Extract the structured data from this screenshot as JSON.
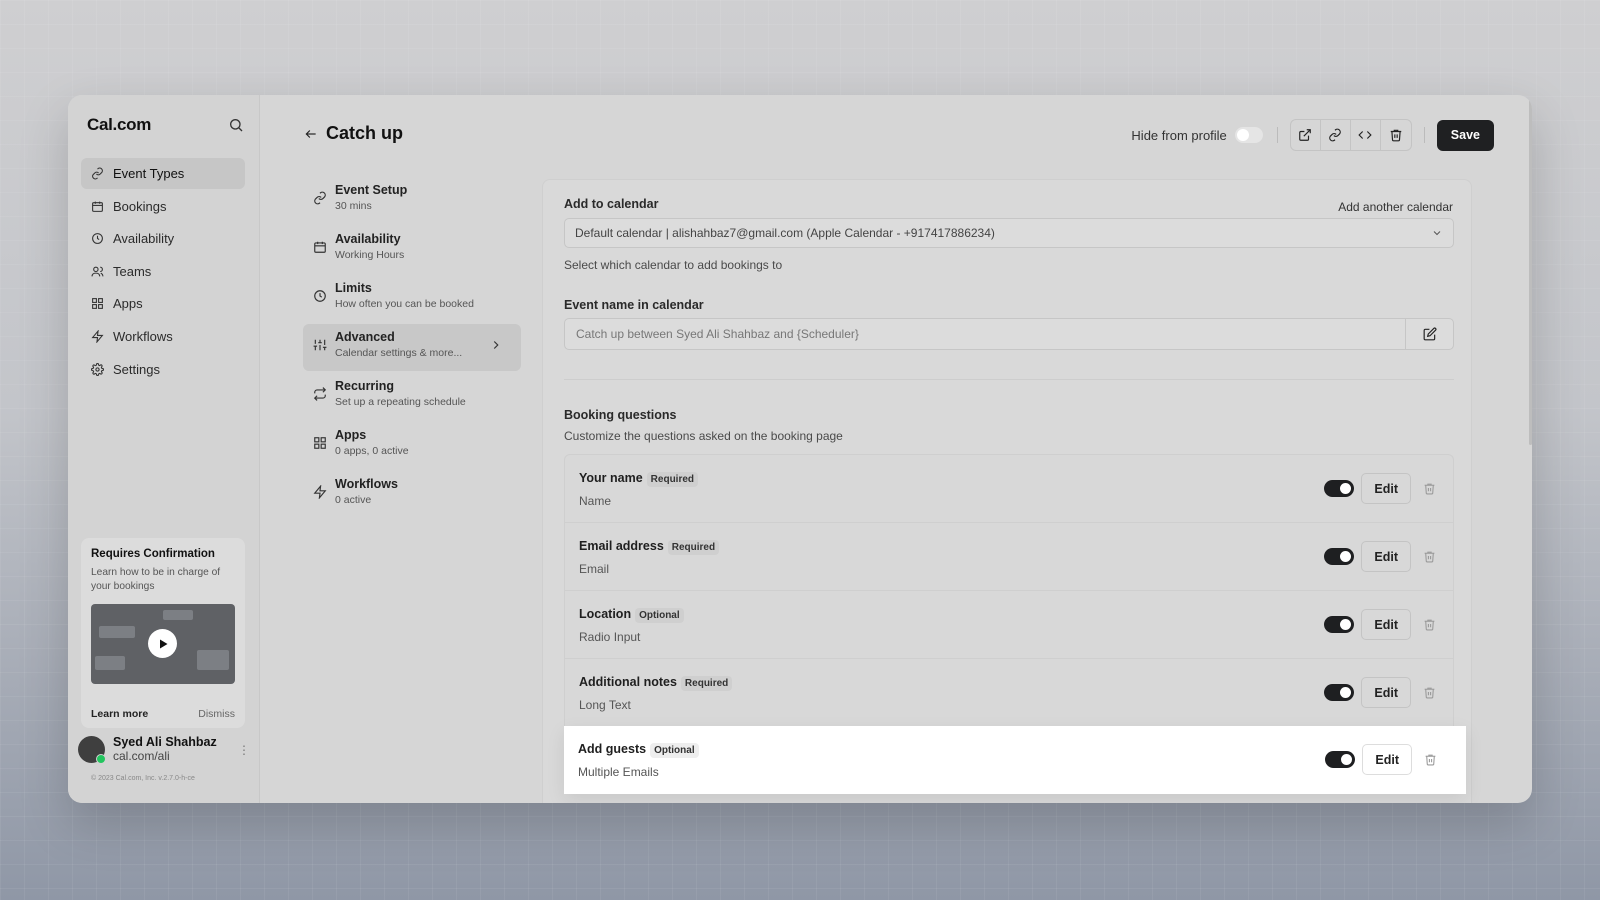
{
  "app": {
    "logo": "Cal.com"
  },
  "sidebar": {
    "items": [
      {
        "label": "Event Types",
        "icon": "link-icon",
        "active": true
      },
      {
        "label": "Bookings",
        "icon": "calendar-icon",
        "active": false
      },
      {
        "label": "Availability",
        "icon": "clock-icon",
        "active": false
      },
      {
        "label": "Teams",
        "icon": "users-icon",
        "active": false
      },
      {
        "label": "Apps",
        "icon": "grid-icon",
        "active": false
      },
      {
        "label": "Workflows",
        "icon": "zap-icon",
        "active": false
      },
      {
        "label": "Settings",
        "icon": "gear-icon",
        "active": false
      }
    ],
    "promo": {
      "title": "Requires Confirmation",
      "text": "Learn how to be in charge of your bookings",
      "learn_more": "Learn more",
      "dismiss": "Dismiss"
    },
    "user": {
      "name": "Syed Ali Shahbaz",
      "url": "cal.com/ali"
    },
    "copyright": "© 2023 Cal.com, Inc. v.2.7.0-h-ce"
  },
  "header": {
    "title": "Catch up",
    "hide_from_profile": "Hide from profile",
    "save": "Save"
  },
  "subnav": [
    {
      "title": "Event Setup",
      "sub": "30 mins",
      "icon": "link-icon"
    },
    {
      "title": "Availability",
      "sub": "Working Hours",
      "icon": "calendar-icon"
    },
    {
      "title": "Limits",
      "sub": "How often you can be booked",
      "icon": "clock-icon"
    },
    {
      "title": "Advanced",
      "sub": "Calendar settings & more...",
      "icon": "sliders-icon"
    },
    {
      "title": "Recurring",
      "sub": "Set up a repeating schedule",
      "icon": "repeat-icon"
    },
    {
      "title": "Apps",
      "sub": "0 apps, 0 active",
      "icon": "grid-icon"
    },
    {
      "title": "Workflows",
      "sub": "0 active",
      "icon": "zap-icon"
    }
  ],
  "advanced": {
    "add_to_calendar": "Add to calendar",
    "add_another": "Add another calendar",
    "calendar_value": "Default calendar | alishahbaz7@gmail.com (Apple Calendar - +917417886234)",
    "calendar_help": "Select which calendar to add bookings to",
    "event_name_label": "Event name in calendar",
    "event_name_placeholder": "Catch up between Syed Ali Shahbaz and {Scheduler}",
    "booking_questions": "Booking questions",
    "booking_questions_help": "Customize the questions asked on the booking page",
    "edit": "Edit",
    "questions": [
      {
        "name": "Your name",
        "badge": "Required",
        "type": "Name"
      },
      {
        "name": "Email address",
        "badge": "Required",
        "type": "Email"
      },
      {
        "name": "Location",
        "badge": "Optional",
        "type": "Radio Input"
      },
      {
        "name": "Additional notes",
        "badge": "Required",
        "type": "Long Text"
      },
      {
        "name": "Add guests",
        "badge": "Optional",
        "type": "Multiple Emails"
      }
    ]
  }
}
